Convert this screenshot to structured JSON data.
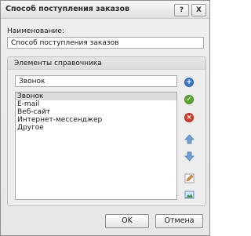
{
  "window": {
    "title": "Способ поступления заказов"
  },
  "titlebar": {
    "help_label": "?",
    "close_label": "X"
  },
  "form": {
    "name_label": "Наименование:",
    "name_value": "Способ поступления заказов"
  },
  "group": {
    "title": "Элементы справочника",
    "edit_value": "Звонок",
    "items": [
      "Звонок",
      "E-mail",
      "Веб-сайт",
      "Интернет-мессенджер",
      "Другое"
    ],
    "selected_index": 0
  },
  "side_buttons": [
    {
      "icon": "add-icon",
      "color": "#3b78c4"
    },
    {
      "icon": "apply-icon",
      "color": "#5aa630"
    },
    {
      "icon": "delete-icon",
      "color": "#d23a2a"
    },
    {
      "icon": "move-up-icon",
      "color": "#6f9fd6"
    },
    {
      "icon": "move-down-icon",
      "color": "#6f9fd6"
    },
    {
      "icon": "edit-icon",
      "color": "#d98c3a"
    },
    {
      "icon": "image-icon",
      "color": "#4a8f4a"
    }
  ],
  "footer": {
    "ok_label": "OK",
    "cancel_label": "Отмена"
  }
}
